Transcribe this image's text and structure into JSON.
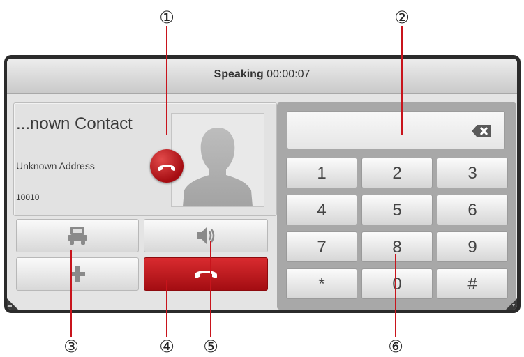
{
  "callouts": [
    "①",
    "②",
    "③",
    "④",
    "⑤",
    "⑥"
  ],
  "status": {
    "label": "Speaking",
    "timer": "00:00:07"
  },
  "contact": {
    "name": "...nown Contact",
    "address": "Unknown Address",
    "number": "10010"
  },
  "icons": {
    "ring": "phone-hangup-icon",
    "avatar": "person-silhouette-icon",
    "transfer": "car-icon",
    "speaker": "speaker-icon",
    "add": "plus-icon",
    "end": "phone-hangup-icon",
    "backspace": "backspace-icon"
  },
  "dialpad": {
    "display_value": "",
    "keys": [
      "1",
      "2",
      "3",
      "4",
      "5",
      "6",
      "7",
      "8",
      "9",
      "*",
      "0",
      "#"
    ]
  },
  "colors": {
    "end_call": "#b71218",
    "leader": "#c8141c"
  }
}
